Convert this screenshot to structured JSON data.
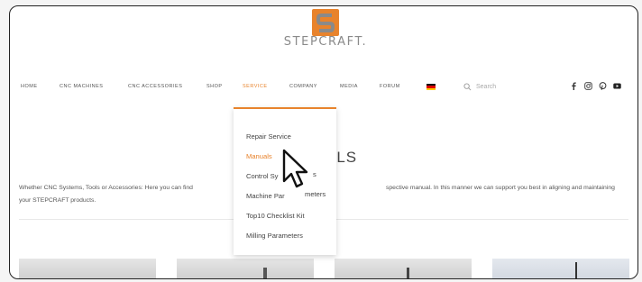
{
  "brand": {
    "name": "STEPCRAFT.",
    "logo_colors": {
      "orange": "#e8832c",
      "gray": "#8a8a8a"
    }
  },
  "nav": {
    "items": [
      {
        "label": "HOME"
      },
      {
        "label": "CNC MACHINES"
      },
      {
        "label": "CNC ACCESSORIES"
      },
      {
        "label": "SHOP"
      },
      {
        "label": "SERVICE",
        "active": true
      },
      {
        "label": "COMPANY"
      },
      {
        "label": "MEDIA"
      },
      {
        "label": "FORUM"
      }
    ],
    "language_flag": "german-flag-icon",
    "search_placeholder": "Search",
    "social_icons": [
      "facebook-icon",
      "instagram-icon",
      "pinterest-icon",
      "youtube-icon"
    ],
    "accent_color": "#e8832c"
  },
  "dropdown": {
    "items": [
      {
        "label": "Repair Service"
      },
      {
        "label": "Manuals",
        "active": true
      },
      {
        "label": "Control Sy"
      },
      {
        "label": "Machine Par"
      },
      {
        "label": "Top10 Checklist Kit"
      },
      {
        "label": "Milling Parameters"
      }
    ]
  },
  "page": {
    "title": "ALS",
    "intro_line1_left": "Whether CNC Systems, Tools or Accessories: Here you can find",
    "intro_line1_right": "spective manual. In this manner we can support you best in aligning and maintaining",
    "intro_line2": "your STEPCRAFT products.",
    "cursor_suffix_1": "s",
    "cursor_suffix_2": "meters"
  }
}
